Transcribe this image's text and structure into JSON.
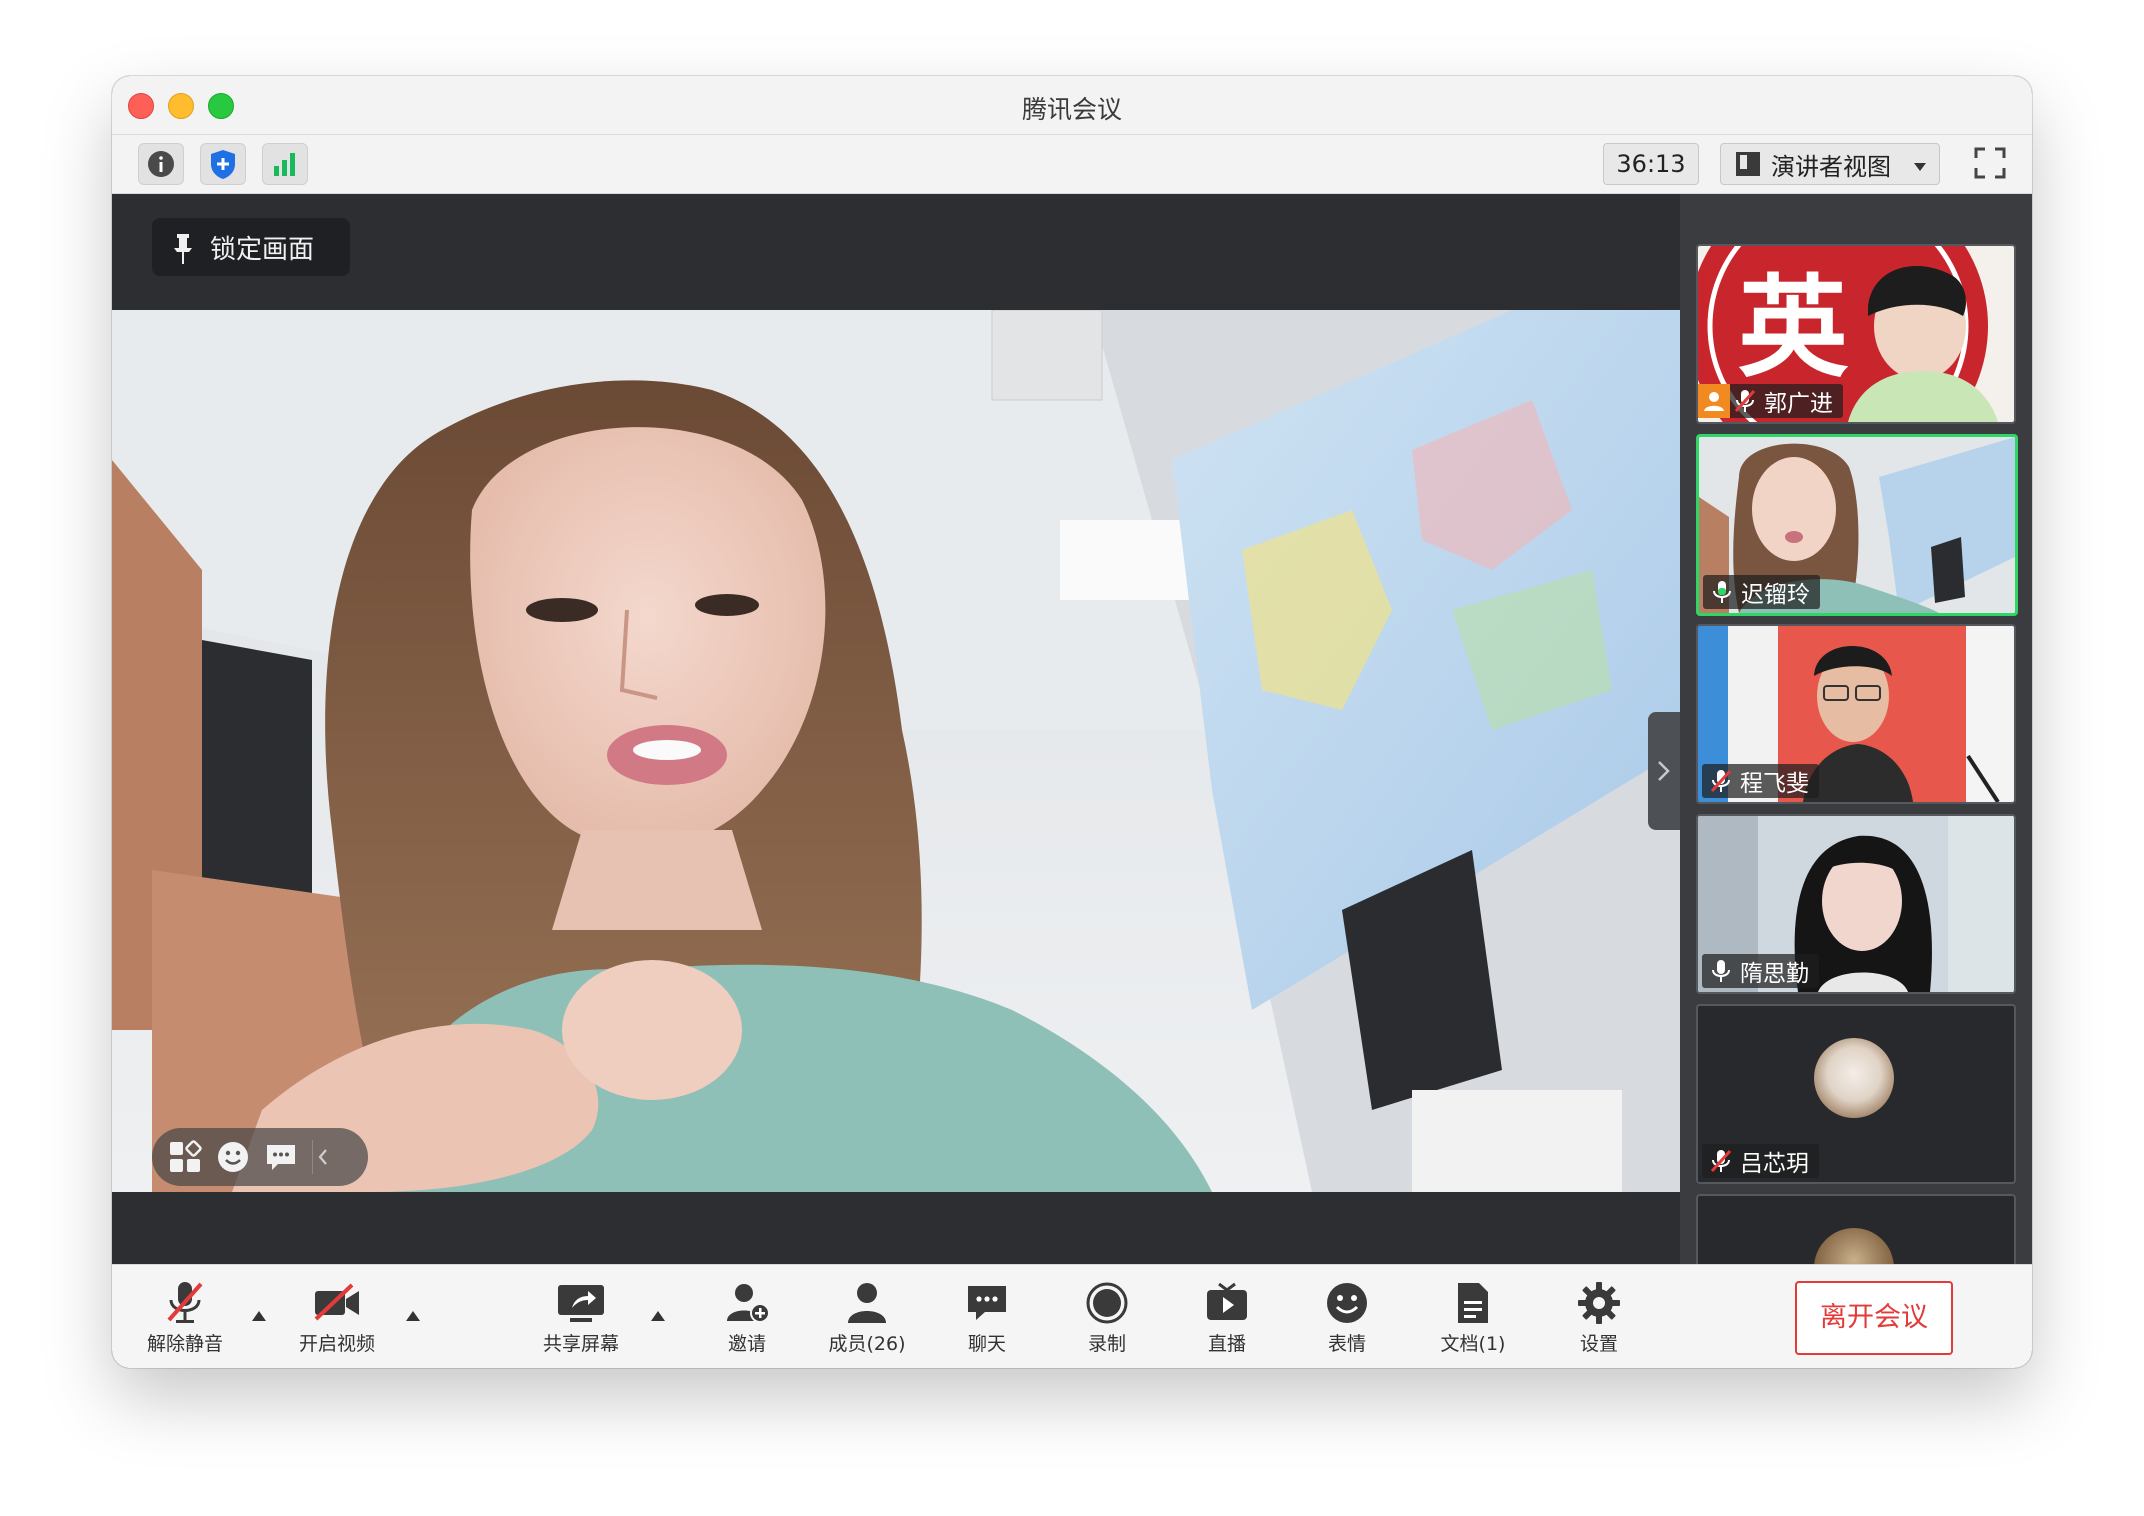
{
  "window": {
    "title": "腾讯会议"
  },
  "toolbar": {
    "timer": "36:13",
    "view_mode": "演讲者视图",
    "icons": [
      "info-icon",
      "shield-icon",
      "signal-icon",
      "fullscreen-icon"
    ]
  },
  "stage": {
    "lock_label": "锁定画面"
  },
  "participants": [
    {
      "name": "郭广进",
      "status": "muted",
      "host": true
    },
    {
      "name": "迟镏玲",
      "status": "speaking",
      "active": true
    },
    {
      "name": "程飞斐",
      "status": "muted"
    },
    {
      "name": "隋思勤",
      "status": "unmuted"
    },
    {
      "name": "吕芯玥",
      "status": "muted",
      "avatar": true
    },
    {
      "name": "",
      "status": "",
      "partial": true
    }
  ],
  "controls": {
    "unmute": "解除静音",
    "start_video": "开启视频",
    "share_screen": "共享屏幕",
    "invite": "邀请",
    "members": "成员(26)",
    "chat": "聊天",
    "record": "录制",
    "live": "直播",
    "reactions": "表情",
    "docs": "文档(1)",
    "settings": "设置",
    "leave": "离开会议"
  },
  "colors": {
    "active_border": "#2dd665",
    "leave_red": "#e33a3a",
    "muted_red": "#e33a3a"
  }
}
